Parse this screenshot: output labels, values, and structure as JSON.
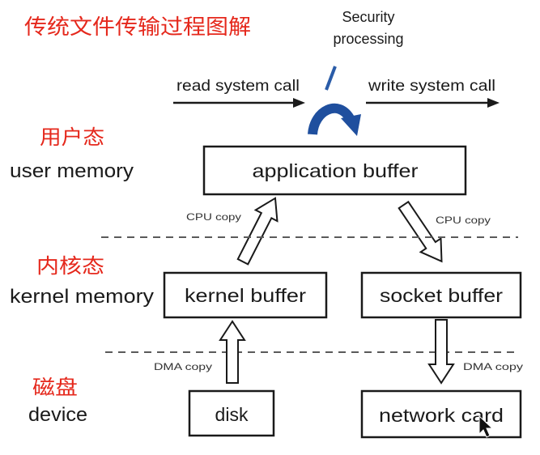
{
  "title": "传统文件传输过程图解",
  "security": {
    "line1": "Security",
    "line2": "processing"
  },
  "syscalls": {
    "read": "read system call",
    "write": "write system call"
  },
  "layers": {
    "user": {
      "cn": "用户态",
      "en": "user memory"
    },
    "kernel": {
      "cn": "内核态",
      "en": "kernel memory"
    },
    "device": {
      "cn": "磁盘",
      "en": "device"
    }
  },
  "buffers": {
    "application": "application buffer",
    "kernel": "kernel buffer",
    "socket": "socket buffer",
    "disk": "disk",
    "network": "network card"
  },
  "copies": {
    "cpu_to_app": "CPU copy",
    "cpu_to_socket": "CPU copy",
    "dma_from_disk": "DMA copy",
    "dma_to_nic": "DMA copy"
  },
  "colors": {
    "label_red": "#e5281c",
    "process_blue": "#1f4f9e"
  },
  "icons": {
    "cursor": "mouse-pointer-icon"
  }
}
